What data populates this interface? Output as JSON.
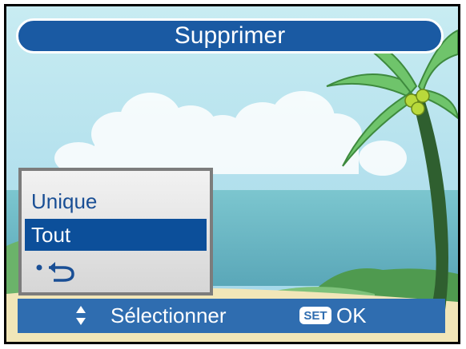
{
  "header": {
    "title": "Supprimer"
  },
  "menu": {
    "items": [
      {
        "label": "Unique",
        "selected": false
      },
      {
        "label": "Tout",
        "selected": true
      },
      {
        "label": "",
        "icon": "back-icon",
        "selected": false
      }
    ]
  },
  "footer": {
    "nav_icon": "up-down-arrows-icon",
    "select_label": "Sélectionner",
    "set_key_label": "SET",
    "ok_label": "OK"
  },
  "colors": {
    "header_bg": "#1a5aa3",
    "selected_bg": "#0c4f9a",
    "item_text": "#1a4f95",
    "footer_bg": "#2f6db0",
    "sky": "#a9dcec",
    "sea": "#67b9c4"
  }
}
